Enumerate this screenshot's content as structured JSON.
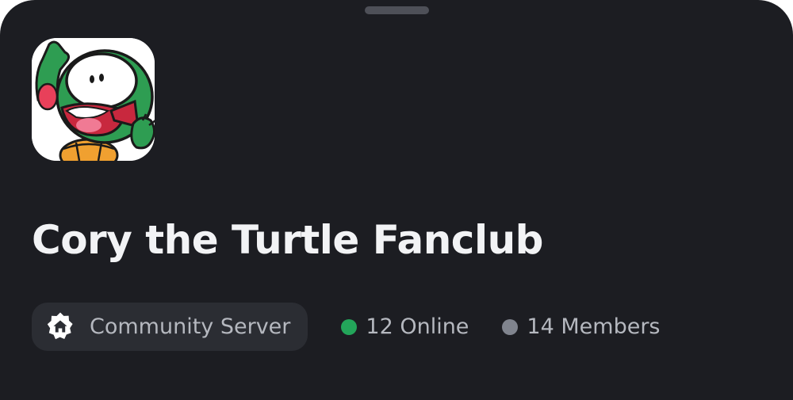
{
  "server": {
    "name": "Cory the Turtle Fanclub",
    "type_label": "Community Server",
    "online_text": "12 Online",
    "members_text": "14 Members"
  },
  "icons": {
    "handle": "drag-handle",
    "avatar": "turtle-mascot-avatar",
    "badge": "community-home-icon",
    "online": "green-status-dot",
    "members": "grey-status-dot"
  },
  "colors": {
    "background": "#1c1d22",
    "badge_background": "#2b2d33",
    "title": "#f2f3f5",
    "muted_text": "#b5b8bf",
    "online_dot": "#23a55a",
    "members_dot": "#80848e",
    "handle": "#4e5058"
  }
}
